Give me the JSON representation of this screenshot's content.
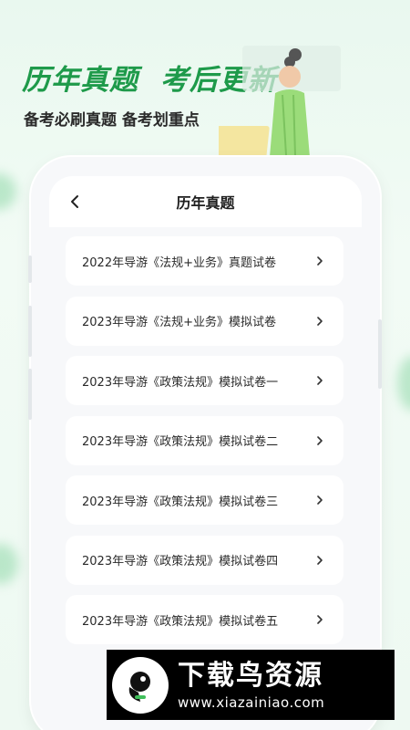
{
  "promo": {
    "headline_part1": "历年真题",
    "headline_part2": "考后更新",
    "subheadline": "备考必刷真题 备考划重点"
  },
  "screen": {
    "title": "历年真题",
    "back_icon": "chevron-left-icon",
    "items": [
      {
        "label": "2022年导游《法规+业务》真题试卷"
      },
      {
        "label": "2023年导游《法规+业务》模拟试卷"
      },
      {
        "label": "2023年导游《政策法规》模拟试卷一"
      },
      {
        "label": "2023年导游《政策法规》模拟试卷二"
      },
      {
        "label": "2023年导游《政策法规》模拟试卷三"
      },
      {
        "label": "2023年导游《政策法规》模拟试卷四"
      },
      {
        "label": "2023年导游《政策法规》模拟试卷五"
      }
    ],
    "item_icon": "chevron-right-icon"
  },
  "watermark": {
    "name": "下载鸟资源",
    "url": "www.xiazainiao.com"
  },
  "colors": {
    "accent": "#1e9a4a",
    "background": "#eaf8ef",
    "card": "#ffffff",
    "watermark_bg": "#000000"
  }
}
